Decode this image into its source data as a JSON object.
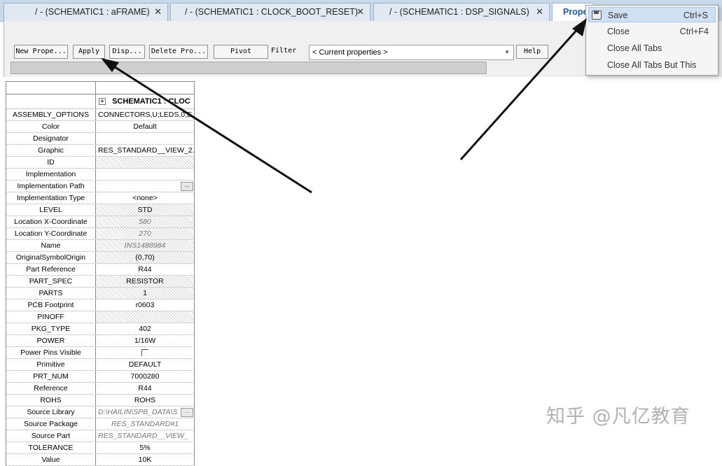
{
  "tabs": [
    {
      "label": "/ - (SCHEMATIC1 : aFRAME)",
      "close": "✕"
    },
    {
      "label": "/ - (SCHEMATIC1 : CLOCK_BOOT_RESET)",
      "close": "✕"
    },
    {
      "label": "/ - (SCHEMATIC1 : DSP_SIGNALS)",
      "close": "✕"
    },
    {
      "label": "Prope"
    }
  ],
  "toolbar": {
    "new_property": "New Prope...",
    "apply": "Apply",
    "display": "Disp...",
    "delete_property": "Delete Pro...",
    "pivot": "Pivot",
    "filter_label": "Filter",
    "filter_value": "< Current properties >",
    "help": "Help"
  },
  "grid": {
    "column_header": "SCHEMATIC1 : CLOC",
    "rows": [
      {
        "key": "ASSEMBLY_OPTIONS",
        "value": "CONNECTORS,U;LEDS,0;E"
      },
      {
        "key": "Color",
        "value": "Default"
      },
      {
        "key": "Designator",
        "value": ""
      },
      {
        "key": "Graphic",
        "value": "RES_STANDARD__VIEW_2."
      },
      {
        "key": "ID",
        "value": ""
      },
      {
        "key": "Implementation",
        "value": ""
      },
      {
        "key": "Implementation Path",
        "value": ""
      },
      {
        "key": "Implementation Type",
        "value": "<none>"
      },
      {
        "key": "LEVEL",
        "value": "STD"
      },
      {
        "key": "Location X-Coordinate",
        "value": "580"
      },
      {
        "key": "Location Y-Coordinate",
        "value": "270"
      },
      {
        "key": "Name",
        "value": "INS1488984"
      },
      {
        "key": "OriginalSymbolOrigin",
        "value": "(0,70)"
      },
      {
        "key": "Part Reference",
        "value": "R44"
      },
      {
        "key": "PART_SPEC",
        "value": "RESISTOR"
      },
      {
        "key": "PARTS",
        "value": "1"
      },
      {
        "key": "PCB Footprint",
        "value": "r0603"
      },
      {
        "key": "PINOFF",
        "value": ""
      },
      {
        "key": "PKG_TYPE",
        "value": "402"
      },
      {
        "key": "POWER",
        "value": "1/16W"
      },
      {
        "key": "Power Pins Visible",
        "value": ""
      },
      {
        "key": "Primitive",
        "value": "DEFAULT"
      },
      {
        "key": "PRT_NUM",
        "value": "7000280"
      },
      {
        "key": "Reference",
        "value": "R44"
      },
      {
        "key": "ROHS",
        "value": "ROHS"
      },
      {
        "key": "Source Library",
        "value": "D:\\HAILIN\\SPB_DATA\\S"
      },
      {
        "key": "Source Package",
        "value": "RES_STANDARD#1"
      },
      {
        "key": "Source Part",
        "value": "RES_STANDARD__VIEW_"
      },
      {
        "key": "TOLERANCE",
        "value": "5%"
      },
      {
        "key": "Value",
        "value": "10K"
      }
    ]
  },
  "context_menu": {
    "items": [
      {
        "label": "Save",
        "shortcut": "Ctrl+S"
      },
      {
        "label": "Close",
        "shortcut": "Ctrl+F4"
      },
      {
        "label": "Close All Tabs",
        "shortcut": ""
      },
      {
        "label": "Close All Tabs But This",
        "shortcut": ""
      }
    ]
  },
  "watermark": "知乎 @凡亿教育",
  "colors": {
    "tab_bar": "#c9d9ea",
    "active_tab_text": "#1d5b9a",
    "menu_highlight": "#cfe0f3"
  }
}
